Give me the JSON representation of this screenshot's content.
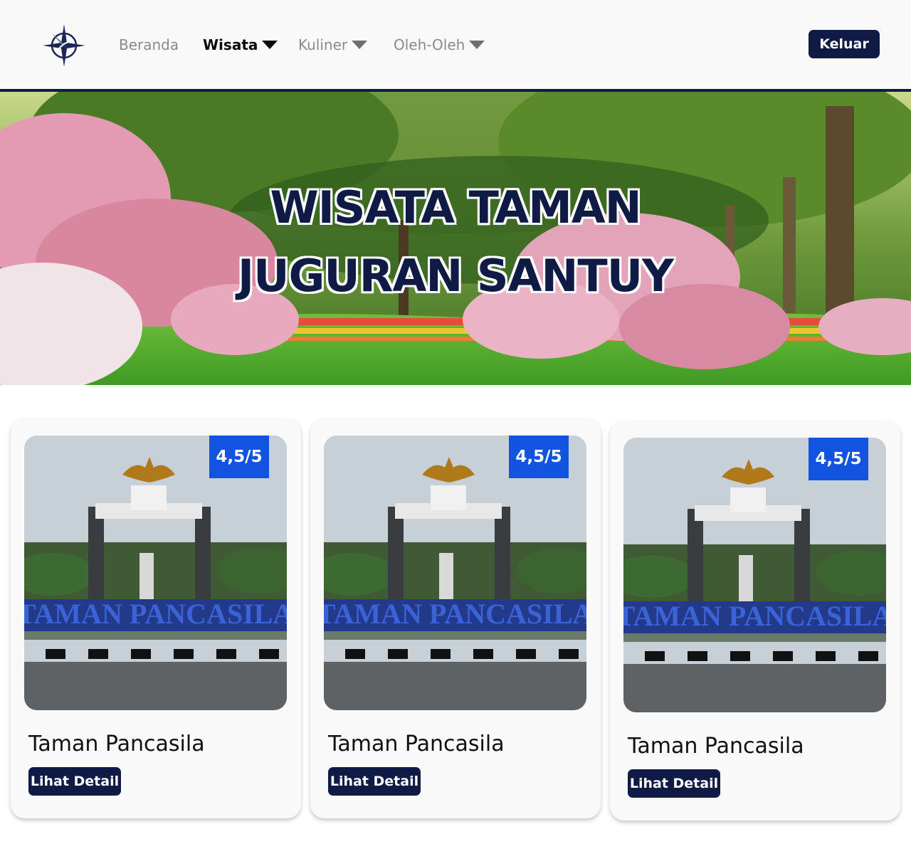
{
  "header": {
    "logo_icon": "compass-star-icon",
    "nav": [
      {
        "label": "Beranda",
        "has_caret": false,
        "active": false
      },
      {
        "label": "Wisata",
        "has_caret": true,
        "active": true
      },
      {
        "label": "Kuliner",
        "has_caret": true,
        "active": false
      },
      {
        "label": "Oleh-Oleh",
        "has_caret": true,
        "active": false
      }
    ],
    "logout_label": "Keluar"
  },
  "hero": {
    "title_line1": "WISATA TAMAN",
    "title_line2": "JUGURAN SANTUY"
  },
  "cards": [
    {
      "title": "Taman Pancasila",
      "rating": "4,5/5",
      "button_label": "Lihat Detail",
      "image_sign_text": "TAMAN PANCASILA"
    },
    {
      "title": "Taman Pancasila",
      "rating": "4,5/5",
      "button_label": "Lihat Detail",
      "image_sign_text": "TAMAN PANCASILA"
    },
    {
      "title": "Taman Pancasila",
      "rating": "4,5/5",
      "button_label": "Lihat Detail",
      "image_sign_text": "TAMAN PANCASILA"
    }
  ],
  "colors": {
    "primary": "#0f1a45",
    "rating_badge": "#1254e0",
    "header_bg": "#f9f9f9",
    "nav_inactive": "#8a8a8a"
  }
}
